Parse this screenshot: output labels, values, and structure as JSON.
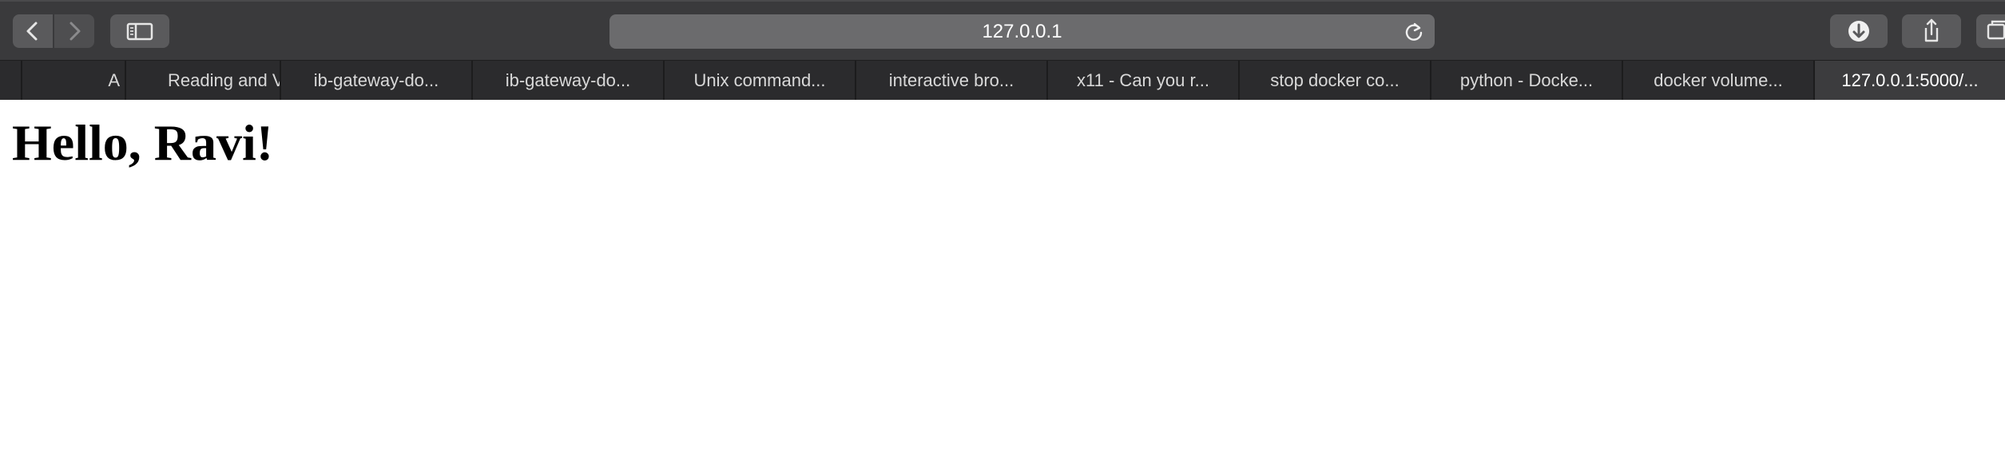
{
  "toolbar": {
    "address": "127.0.0.1",
    "icons": {
      "back": "chevron-left-icon",
      "forward": "chevron-right-icon",
      "sidebar": "sidebar-icon",
      "reload": "reload-icon",
      "download": "download-icon",
      "share": "share-icon",
      "tabs": "tabs-icon"
    }
  },
  "tabs": [
    {
      "label": ""
    },
    {
      "label": "A"
    },
    {
      "label": "Reading and V"
    },
    {
      "label": "ib-gateway-do..."
    },
    {
      "label": "ib-gateway-do..."
    },
    {
      "label": "Unix command..."
    },
    {
      "label": "interactive bro..."
    },
    {
      "label": "x11 - Can you r..."
    },
    {
      "label": "stop docker co..."
    },
    {
      "label": "python - Docke..."
    },
    {
      "label": "docker volume..."
    },
    {
      "label": "127.0.0.1:5000/..."
    }
  ],
  "page": {
    "heading": "Hello, Ravi!"
  }
}
